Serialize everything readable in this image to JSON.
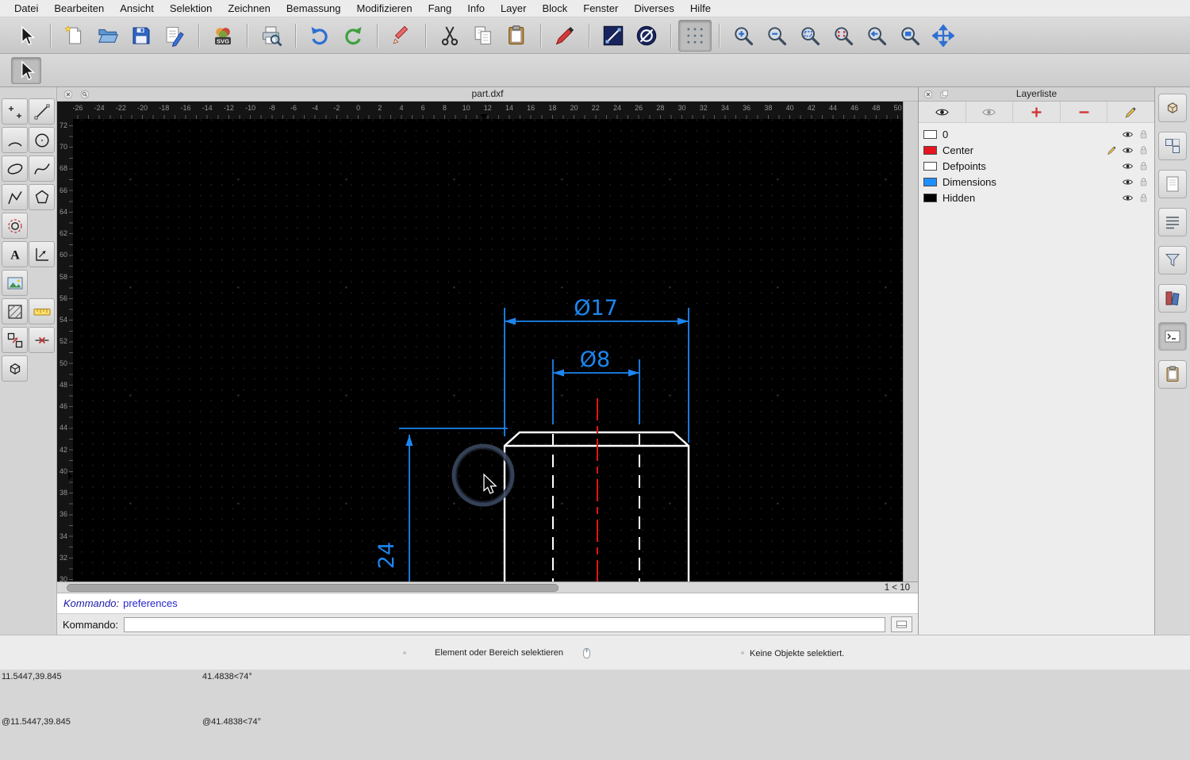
{
  "menubar": {
    "items": [
      "Datei",
      "Bearbeiten",
      "Ansicht",
      "Selektion",
      "Zeichnen",
      "Bemassung",
      "Modifizieren",
      "Fang",
      "Info",
      "Layer",
      "Block",
      "Fenster",
      "Diverses",
      "Hilfe"
    ]
  },
  "toolbar": {
    "groups": [
      [
        "select"
      ],
      [
        "new",
        "open",
        "save",
        "save-as"
      ],
      [
        "svg-export"
      ],
      [
        "print-preview"
      ],
      [
        "undo",
        "redo"
      ],
      [
        "erase"
      ],
      [
        "cut",
        "copy",
        "paste"
      ],
      [
        "attributes"
      ],
      [
        "line-properties",
        "circle-properties"
      ],
      [
        "grid"
      ],
      [
        "zoom-in",
        "zoom-out",
        "zoom-auto",
        "zoom-refresh",
        "zoom-previous",
        "zoom-window",
        "pan"
      ]
    ],
    "active": [
      "grid"
    ]
  },
  "tool_options": {
    "icons": [
      "select"
    ],
    "active": "select"
  },
  "palette": {
    "rows": [
      [
        "point",
        "line"
      ],
      [
        "arc",
        "circle"
      ],
      [
        "ellipse",
        "spline"
      ],
      [
        "polyline",
        "polygon"
      ],
      [
        "offset",
        null
      ],
      [
        "text",
        "dimension"
      ],
      [
        "image",
        null
      ],
      [
        "hatch",
        "measure"
      ],
      [
        "modify",
        "snap"
      ],
      [
        "solid",
        null
      ]
    ]
  },
  "document": {
    "title": "part.dxf",
    "zoom_indicator": "1 < 10",
    "dimensions": {
      "d17": "Ø17",
      "d8": "Ø8",
      "v24": "24"
    }
  },
  "rulers": {
    "horizontal": [
      -26,
      -24,
      -22,
      -20,
      -18,
      -16,
      -14,
      -12,
      -10,
      -8,
      -6,
      -4,
      -2,
      0,
      2,
      4,
      6,
      8,
      10,
      12,
      14,
      16,
      18,
      20,
      22,
      24,
      26,
      28,
      30,
      32,
      34,
      36,
      38,
      40,
      42,
      44,
      46,
      48,
      50
    ],
    "vertical": [
      72,
      70,
      68,
      66,
      64,
      62,
      60,
      58,
      56,
      54,
      52,
      50,
      48,
      46,
      44,
      42,
      40,
      38,
      36,
      34,
      32,
      30
    ]
  },
  "command": {
    "history_label": "Kommando:",
    "history_text": "preferences",
    "prompt_label": "Kommando:",
    "input_value": ""
  },
  "layer_panel": {
    "title": "Layerliste",
    "toolbar": [
      {
        "name": "show-all-layers",
        "icon": "eye"
      },
      {
        "name": "toggle-layer-visibility",
        "icon": "eye-off"
      },
      {
        "name": "add-layer",
        "icon": "plus"
      },
      {
        "name": "remove-layer",
        "icon": "minus"
      },
      {
        "name": "edit-layer",
        "icon": "pen"
      }
    ],
    "layers": [
      {
        "name": "0",
        "color": "#ffffff",
        "current": false
      },
      {
        "name": "Center",
        "color": "#e8141e",
        "current": true
      },
      {
        "name": "Defpoints",
        "color": "#ffffff",
        "current": false
      },
      {
        "name": "Dimensions",
        "color": "#1e8fff",
        "current": false
      },
      {
        "name": "Hidden",
        "color": "#000000",
        "current": false
      }
    ]
  },
  "right_dock": {
    "icons": [
      "property-editor",
      "block-list",
      "sheet",
      "view-list",
      "filter",
      "library",
      "command-line",
      "clipboard-panel"
    ],
    "active": "command-line"
  },
  "statusbar": {
    "abs_coord": "11.5447,39.845",
    "rel_coord": "@11.5447,39.845",
    "abs_polar": "41.4838<74°",
    "rel_polar": "@41.4838<74°",
    "hint": "Element oder Bereich selektieren",
    "selection_info": "Keine Objekte selektiert."
  },
  "colors": {
    "dimension": "#1d86f0",
    "centerline": "#e01414",
    "outline": "#ffffff",
    "snap_indicator": "#38455c"
  }
}
